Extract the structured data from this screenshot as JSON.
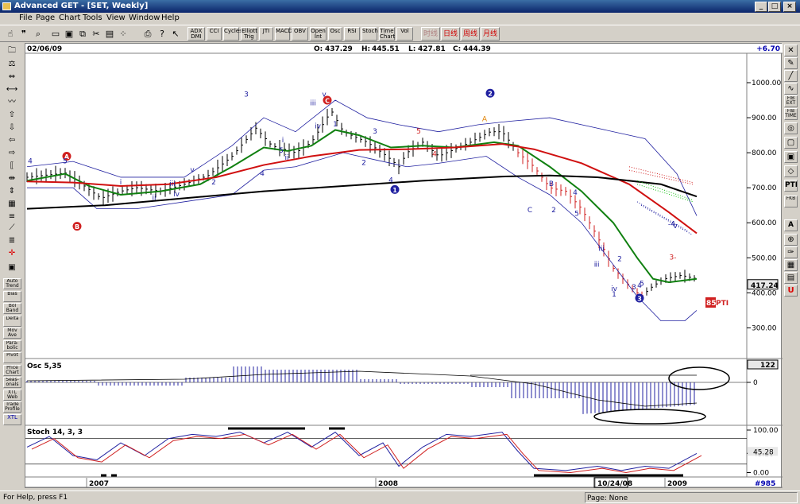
{
  "window": {
    "title": "Advanced GET - [SET, Weekly]"
  },
  "menu": [
    "File",
    "Page",
    "Chart",
    "Tools",
    "View",
    "Window",
    "Help"
  ],
  "toolbar": {
    "icons": [
      "hand-icon",
      "quote-icon",
      "magnify-icon",
      "page-icon",
      "save-icon",
      "copy-icon",
      "cut-icon",
      "paste-icon",
      "dots-icon",
      "print-icon",
      "help-icon",
      "pointer-help-icon"
    ],
    "study_buttons": [
      "ADX DMI",
      "CCI",
      "Cycles",
      "Elliott Trig",
      "JTI",
      "MACD",
      "OBV",
      "Open Int",
      "Osc",
      "RSI",
      "Stoch",
      "Time Chart",
      "Vol"
    ],
    "period_buttons": [
      "时线",
      "日线",
      "周线",
      "月线"
    ],
    "period_colors": [
      "#b08080",
      "#d00000",
      "#d00000",
      "#d00000"
    ]
  },
  "left_toolbar": [
    "Auto Trend",
    "Bias",
    "Bol Band",
    "Delta",
    "Mov Ave",
    "Para-bolic",
    "Pivot",
    "Price Chart",
    "Seas-onals",
    "XTL Web",
    "Trade Profile",
    "XTL"
  ],
  "left_icons": [
    "folder-icon",
    "scale-icon",
    "reset-icon",
    "study-icon",
    "elliott-icon",
    "up-arrow-icon",
    "down-arrow-icon",
    "left-arrow-icon",
    "right-arrow-icon",
    "bracket-icon",
    "expand-icon",
    "compress-icon",
    "grid-icon",
    "lines-icon",
    "gann-icon",
    "fib-icon",
    "cross-icon",
    "window-icon"
  ],
  "right_toolbar": [
    "FIB RET",
    "FIB EXT",
    "FIB TIME",
    "PTI",
    "FKB",
    "A"
  ],
  "header": {
    "date": "02/06/09",
    "open_label": "O:",
    "open": "437.29",
    "high_label": "H:",
    "high": "445.51",
    "low_label": "L:",
    "low": "427.81",
    "close_label": "C:",
    "close": "444.39",
    "change": "+6.70"
  },
  "price_panel": {
    "ticks": [
      "1000.00",
      "900.00",
      "800.00",
      "700.00",
      "600.00",
      "500.00",
      "400.00",
      "300.00"
    ],
    "last_price": "417.24",
    "pti_value": "85",
    "pti_label": "PTI"
  },
  "osc_panel": {
    "title": "Osc 5,35",
    "value": "122",
    "ticks": [
      "0"
    ]
  },
  "stoch_panel": {
    "title": "Stoch 14, 3, 3",
    "ticks": [
      "100.00",
      "45.28",
      "0.00"
    ]
  },
  "x_axis": {
    "labels": [
      "2007",
      "2008",
      "10/24/08",
      "2009"
    ],
    "bar_count": "#985"
  },
  "wave_labels": {
    "price": [
      "A",
      "B",
      "C",
      "1",
      "2",
      "3",
      "4",
      "5",
      "i",
      "ii",
      "iii",
      "iv",
      "v",
      "2",
      "3",
      "4",
      "5",
      "i",
      "ii",
      "iii",
      "iv",
      "v",
      "1",
      "2",
      "3",
      "4",
      "5",
      "4",
      "A",
      "B",
      "C",
      "2",
      "1",
      "2",
      "3",
      "4",
      "5",
      "i",
      "ii",
      "iii",
      "iv",
      "v",
      "4",
      "5",
      "3-",
      "-4-",
      "-4-"
    ]
  },
  "statusbar": {
    "help": "For Help, press F1",
    "page": "Page: None"
  },
  "colors": {
    "titlebar": "#0a246a",
    "ma_green": "#108010",
    "ma_red": "#d01010",
    "ma_black": "#000000",
    "wave_blue": "#2020a0",
    "wave_red": "#d02020"
  }
}
